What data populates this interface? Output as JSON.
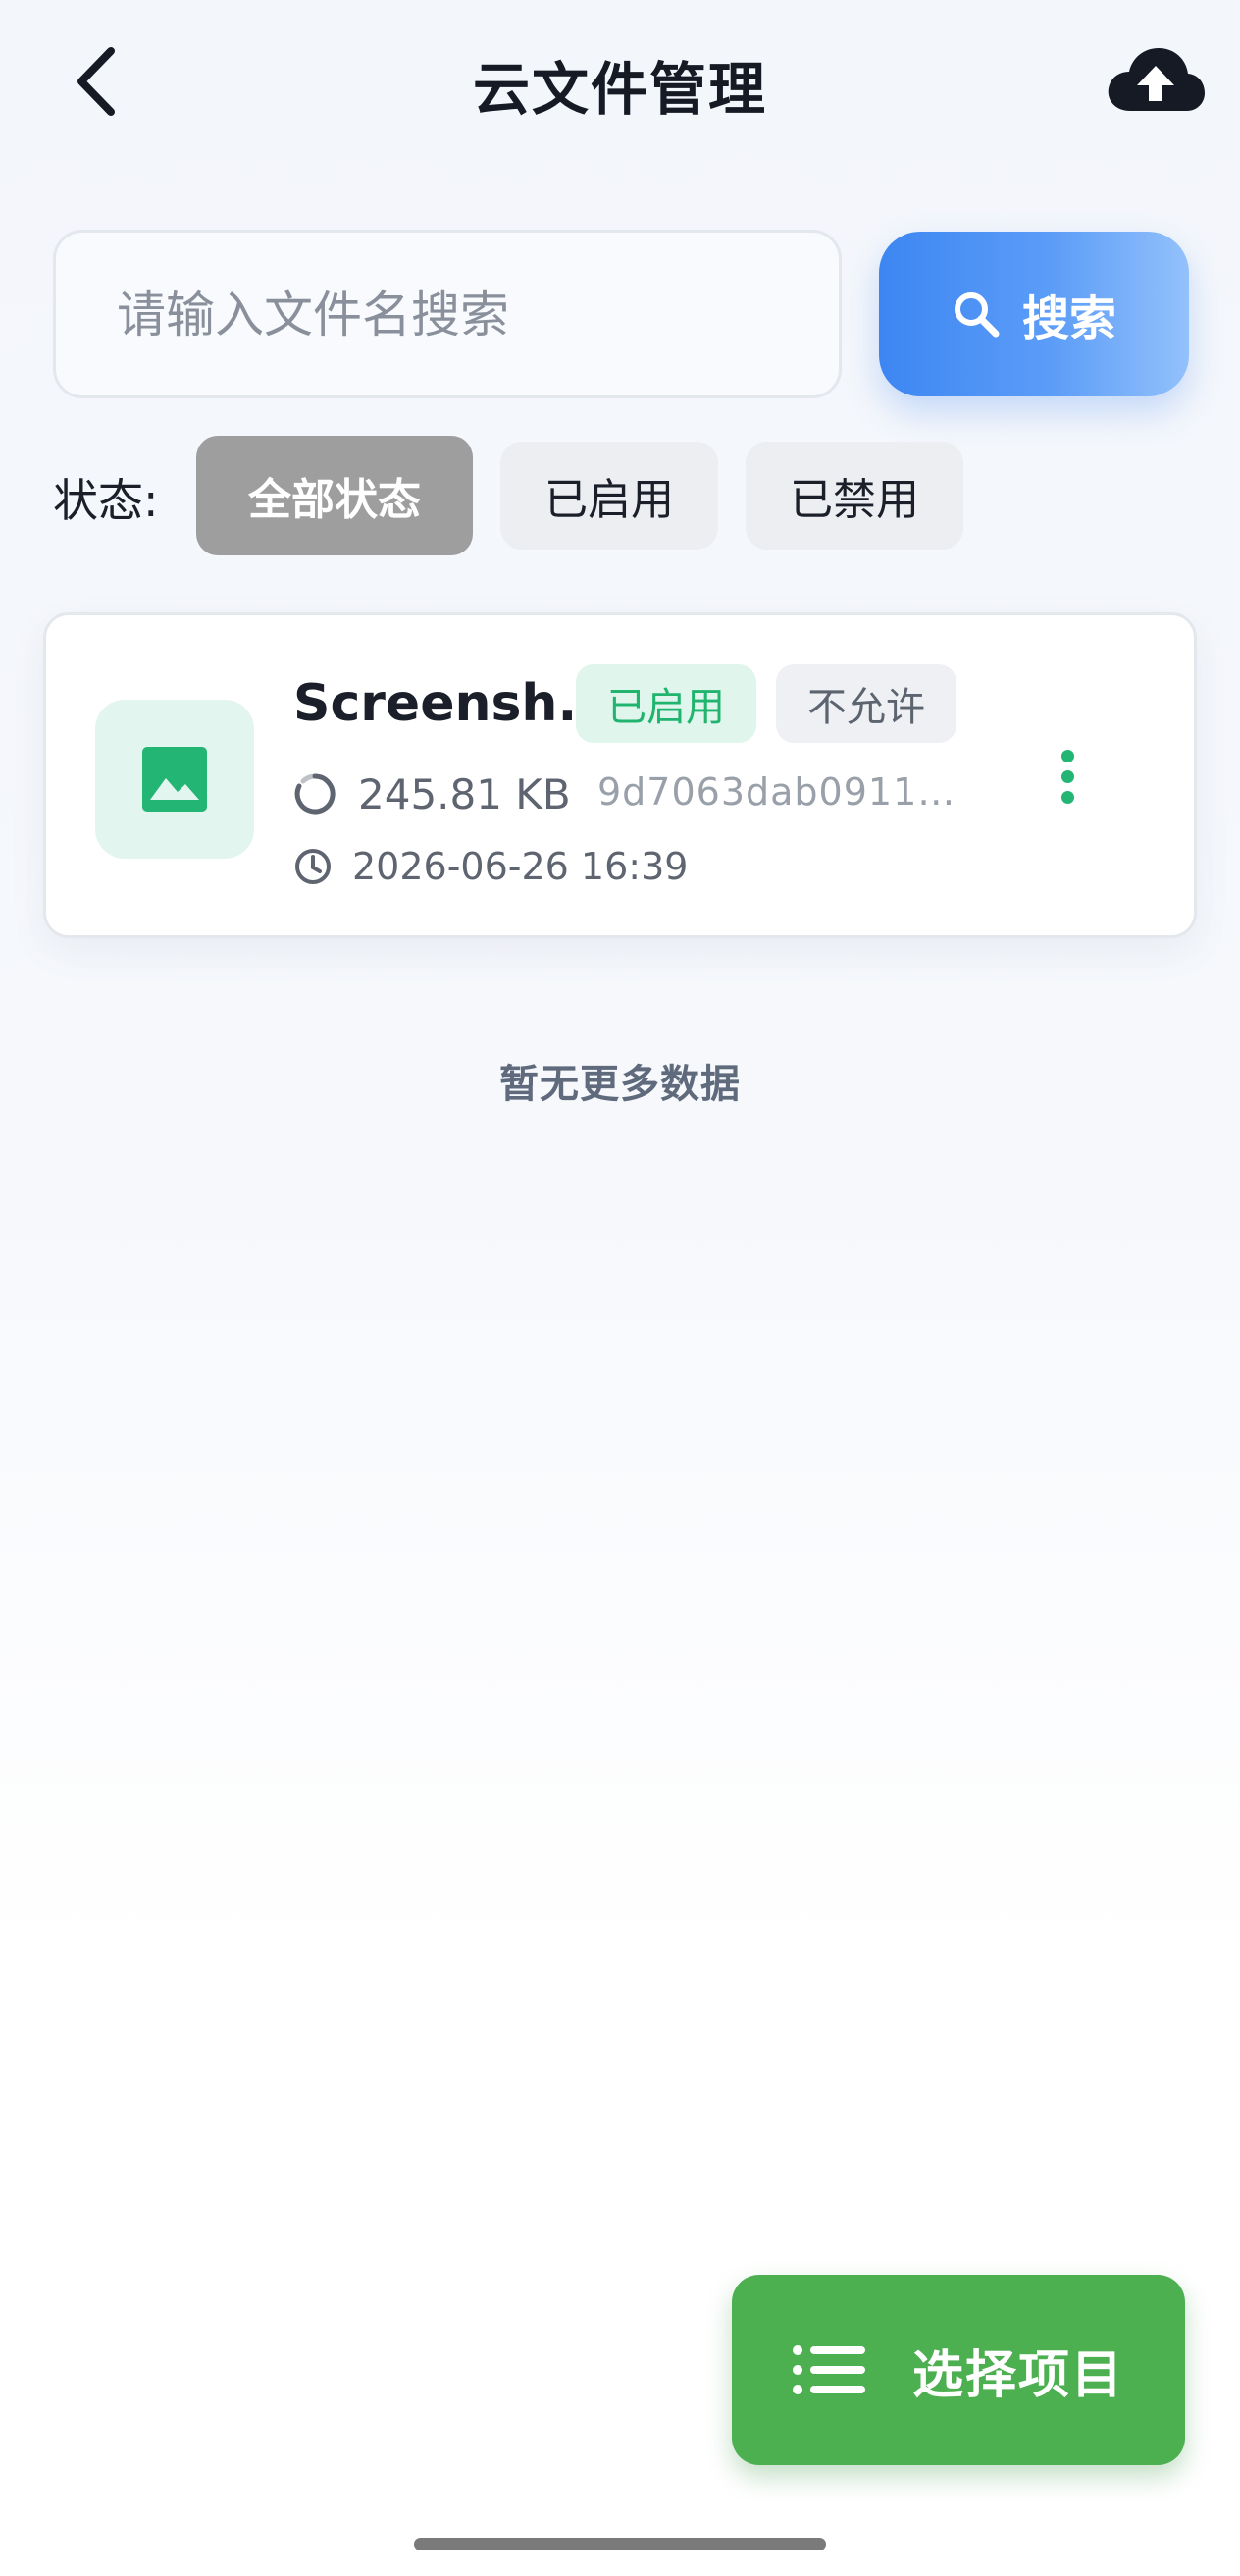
{
  "header": {
    "title": "云文件管理",
    "back_icon": "chevron-left-icon",
    "upload_icon": "cloud-upload-icon"
  },
  "search": {
    "placeholder": "请输入文件名搜索",
    "value": "",
    "button_label": "搜索",
    "button_icon": "search-icon"
  },
  "filter": {
    "label": "状态:",
    "options": [
      "全部状态",
      "已启用",
      "已禁用"
    ],
    "selected": "全部状态"
  },
  "files": [
    {
      "name": "Screensh...",
      "status_badge": "已启用",
      "permission_badge": "不允许",
      "size": "245.81 KB",
      "hash": "9d7063dab0911c...",
      "time": "2026-06-26 16:39",
      "type_icon": "image-icon"
    }
  ],
  "list_footer": "暂无更多数据",
  "fab": {
    "label": "选择项目",
    "icon": "list-icon"
  },
  "colors": {
    "accent_blue": "#3d86f2",
    "success_green": "#20b46f",
    "fab_green": "#4caf50",
    "chip_selected": "#9e9e9e"
  }
}
